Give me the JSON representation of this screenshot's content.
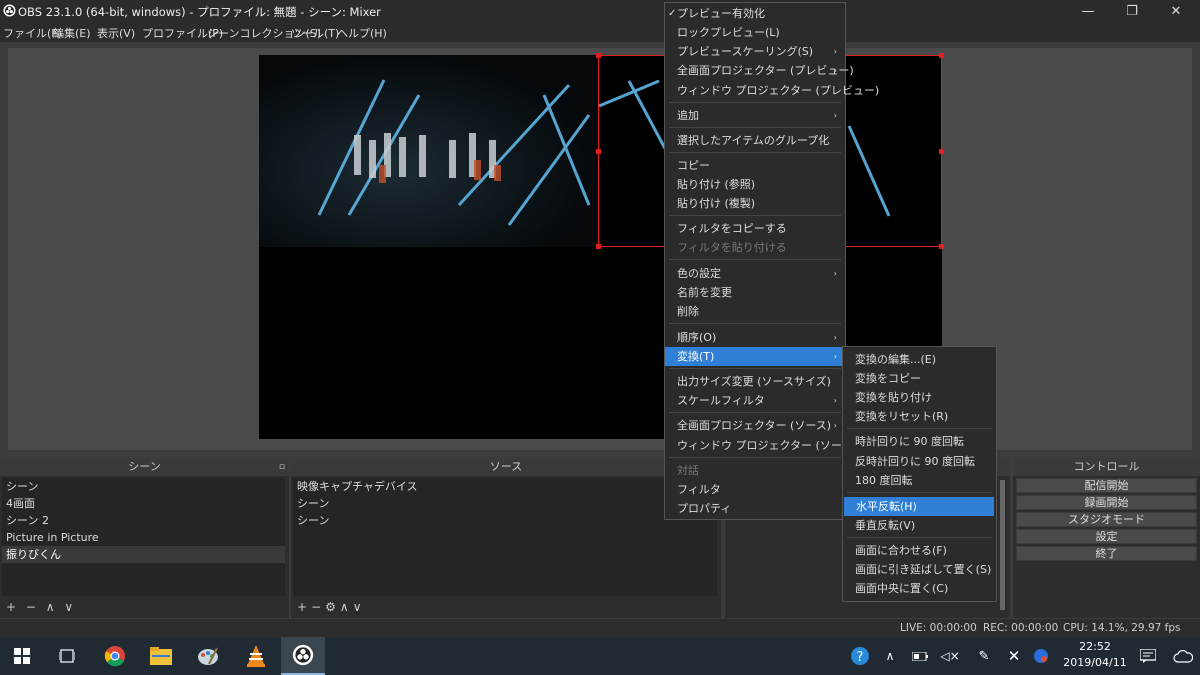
{
  "window": {
    "title": "OBS 23.1.0 (64-bit, windows) - プロファイル: 無題 - シーン: Mixer",
    "controls": {
      "minimize": "—",
      "maximize": "❐",
      "close": "✕"
    }
  },
  "menubar": [
    "ファイル(F)",
    "編集(E)",
    "表示(V)",
    "プロファイル(P)",
    "シーンコレクション(S)",
    "ツール(T)",
    "ヘルプ(H)"
  ],
  "scenes": {
    "title": "シーン",
    "items": [
      "シーン",
      "4画面",
      "シーン 2",
      "Picture in Picture",
      "振りびくん"
    ],
    "selected_index": 4,
    "toolbar": "+ − ∧ ∨"
  },
  "sources": {
    "title": "ソース",
    "items": [
      "映像キャプチャデバイス",
      "シーン",
      "シーン"
    ],
    "toolbar_add": "+",
    "toolbar_remove": "−",
    "toolbar_up": "∧",
    "toolbar_down": "∨"
  },
  "controls": {
    "title": "コントロール",
    "buttons": [
      "配信開始",
      "録画開始",
      "スタジオモード",
      "設定",
      "終了"
    ]
  },
  "status": {
    "live": "LIVE: 00:00:00",
    "rec": "REC: 00:00:00",
    "cpu": "CPU: 14.1%, 29.97 fps"
  },
  "taskbar": {
    "time": "22:52",
    "date": "2019/04/11"
  },
  "context_menu": {
    "items": [
      {
        "label": "プレビュー有効化",
        "check": "✓"
      },
      {
        "label": "ロックプレビュー(L)"
      },
      {
        "label": "プレビュースケーリング(S)",
        "sub": "›"
      },
      {
        "label": "全画面プロジェクター (プレビュー)",
        "sub": "›"
      },
      {
        "label": "ウィンドウ プロジェクター (プレビュー)"
      },
      {
        "label": "追加",
        "sub": "›"
      },
      {
        "label": "選択したアイテムのグループ化"
      },
      {
        "label": "コピー"
      },
      {
        "label": "貼り付け (参照)"
      },
      {
        "label": "貼り付け (複製)"
      },
      {
        "label": "フィルタをコピーする"
      },
      {
        "label": "フィルタを貼り付ける"
      },
      {
        "label": "色の設定",
        "sub": "›"
      },
      {
        "label": "名前を変更"
      },
      {
        "label": "削除"
      },
      {
        "label": "順序(O)",
        "sub": "›"
      },
      {
        "label": "変換(T)",
        "sub": "›"
      },
      {
        "label": "出力サイズ変更 (ソースサイズ)"
      },
      {
        "label": "スケールフィルタ",
        "sub": "›"
      },
      {
        "label": "全画面プロジェクター (ソース)",
        "sub": "›"
      },
      {
        "label": "ウィンドウ プロジェクター (ソース)"
      },
      {
        "label": "対話"
      },
      {
        "label": "フィルタ"
      },
      {
        "label": "プロパティ"
      }
    ]
  },
  "transform_menu": {
    "items": [
      {
        "label": "変換の編集...(E)"
      },
      {
        "label": "変換をコピー"
      },
      {
        "label": "変換を貼り付け"
      },
      {
        "label": "変換をリセット(R)"
      },
      {
        "label": "時計回りに 90 度回転"
      },
      {
        "label": "反時計回りに 90 度回転"
      },
      {
        "label": "180 度回転"
      },
      {
        "label": "水平反転(H)"
      },
      {
        "label": "垂直反転(V)"
      },
      {
        "label": "画面に合わせる(F)"
      },
      {
        "label": "画面に引き延ばして置く(S)"
      },
      {
        "label": "画面中央に置く(C)"
      }
    ]
  },
  "colors": {
    "accent": "#2f7fd6",
    "selection": "#e02020"
  }
}
